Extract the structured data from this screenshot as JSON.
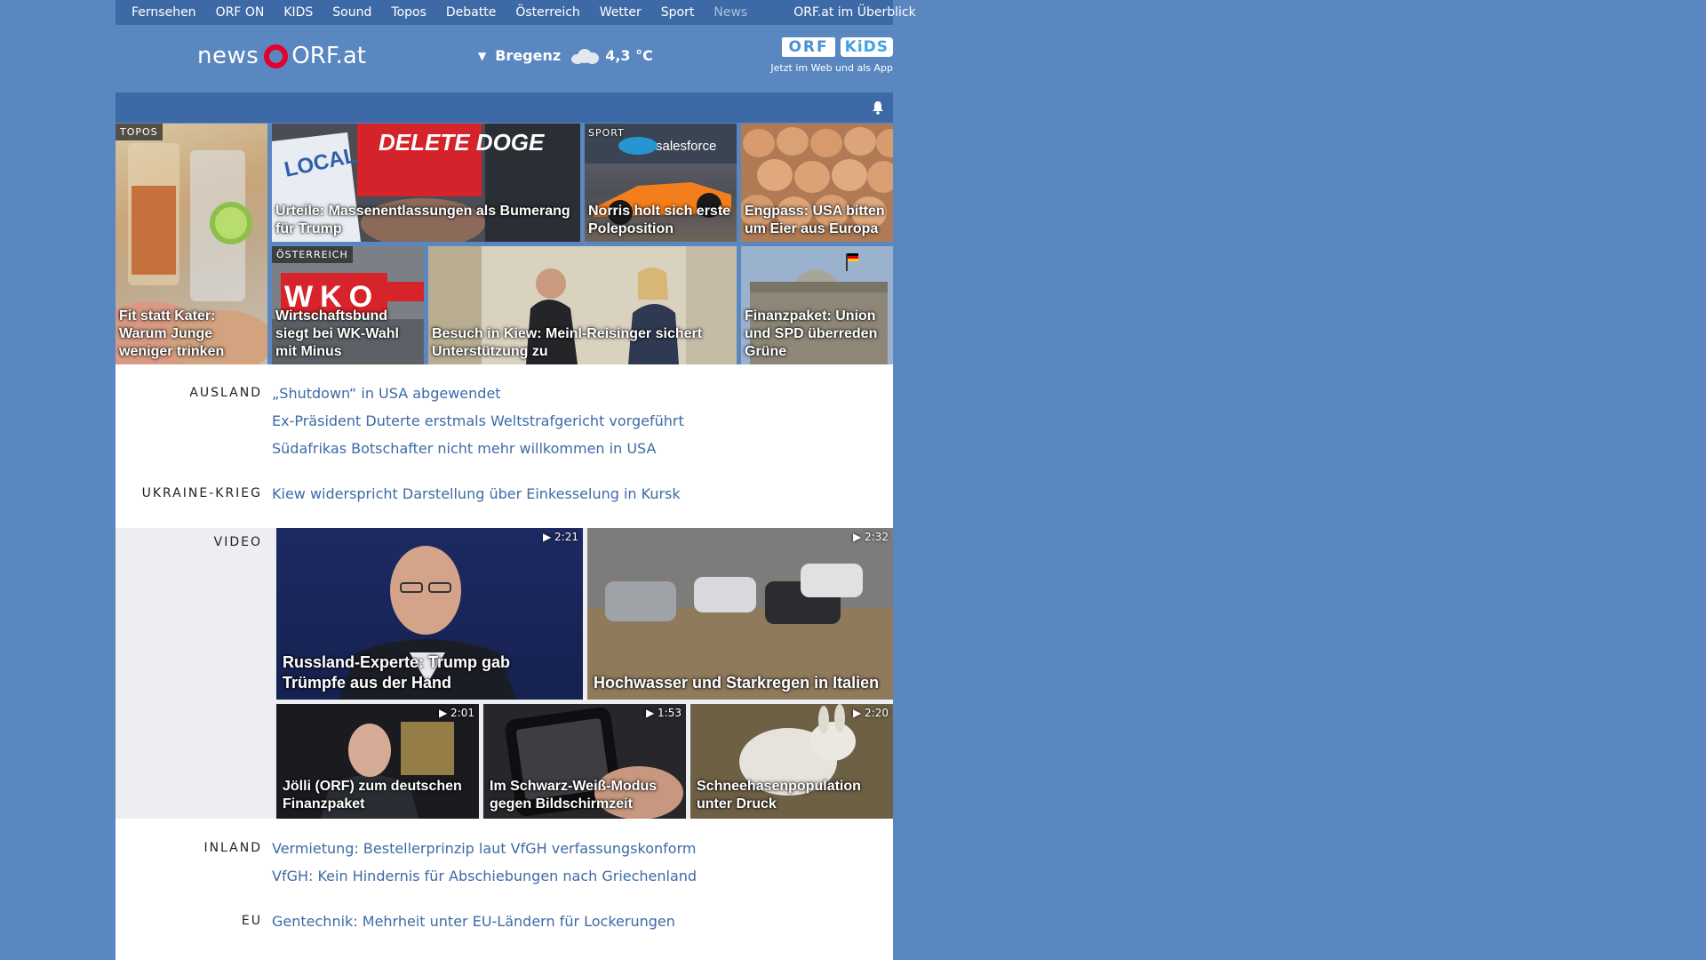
{
  "topnav": {
    "items": [
      "Fernsehen",
      "ORF ON",
      "KIDS",
      "Sound",
      "Topos",
      "Debatte",
      "Österreich",
      "Wetter",
      "Sport",
      "News"
    ],
    "overview": "ORF.at im Überblick"
  },
  "header": {
    "logo_news": "news",
    "logo_orf": "ORF.at",
    "weather": {
      "city": "Bregenz",
      "temp": "4,3 °C",
      "icon": "cloud-icon"
    },
    "kids": {
      "badge1": "ORF",
      "badge2": "KiDS",
      "subtitle": "Jetzt im Web und als App"
    }
  },
  "teasers": [
    {
      "tag": "TOPOS",
      "caption": "Fit statt Kater: Warum Junge weniger trinken"
    },
    {
      "tag": "",
      "caption": "Urteile: Massenentlassungen als Bumerang für Trump"
    },
    {
      "tag": "SPORT",
      "caption": "Norris holt sich erste Poleposition"
    },
    {
      "tag": "",
      "caption": "Engpass: USA bitten um Eier aus Europa"
    },
    {
      "tag": "ÖSTERREICH",
      "caption": "Wirtschaftsbund siegt bei WK-Wahl mit Minus"
    },
    {
      "tag": "",
      "caption": "Besuch in Kiew: Meinl-Reisinger sichert Unterstützung zu"
    },
    {
      "tag": "",
      "caption": "Finanzpaket: Union und SPD überreden Grüne"
    }
  ],
  "image_texts": {
    "delete_doge": "DELETE DOGE",
    "local": "LOCAL",
    "wko": "WKO",
    "salesforce": "salesforce"
  },
  "sections": {
    "ausland": {
      "label": "AUSLAND",
      "links": [
        "„Shutdown“ in USA abgewendet",
        "Ex-Präsident Duterte erstmals Weltstrafgericht vorgeführt",
        "Südafrikas Botschafter nicht mehr willkommen in USA"
      ]
    },
    "ukraine": {
      "label": "UKRAINE-KRIEG",
      "links": [
        "Kiew widerspricht Darstellung über Einkesselung in Kursk"
      ]
    },
    "video": {
      "label": "VIDEO",
      "items": [
        {
          "duration": "2:21",
          "caption": "Russland-Experte: Trump gab Trümpfe aus der Hand"
        },
        {
          "duration": "2:32",
          "caption": "Hochwasser und Starkregen in Italien"
        },
        {
          "duration": "2:01",
          "caption": "Jölli (ORF) zum deutschen Finanzpaket"
        },
        {
          "duration": "1:53",
          "caption": "Im Schwarz-Weiß-Modus gegen Bildschirmzeit"
        },
        {
          "duration": "2:20",
          "caption": "Schneehasenpopulation unter Druck"
        }
      ]
    },
    "inland": {
      "label": "INLAND",
      "links": [
        "Vermietung: Bestellerprinzip laut VfGH verfassungskonform",
        "VfGH: Kein Hindernis für Abschiebungen nach Griechenland"
      ]
    },
    "eu": {
      "label": "EU",
      "links": [
        "Gentechnik: Mehrheit unter EU-Ländern für Lockerungen"
      ]
    }
  },
  "colors": {
    "background": "#5a87c0",
    "nav": "#3d6aa6",
    "link": "#3d6aa6",
    "orf_red": "#e3002b"
  }
}
